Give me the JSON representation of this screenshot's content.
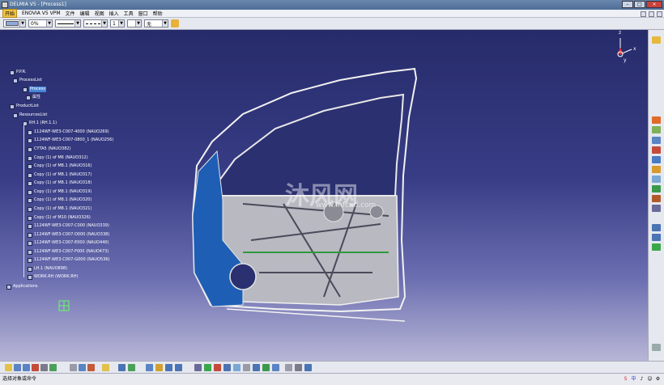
{
  "title": "DELMIA V5 - [Process1]",
  "window_buttons": [
    "–",
    "□",
    "×"
  ],
  "menu": [
    "开始",
    "ENOVIA V5 VPM",
    "文件",
    "编辑",
    "视图",
    "插入",
    "工具",
    "窗口",
    "帮助"
  ],
  "prop_toolbar": {
    "fill_value": "",
    "transparency_value": "0%",
    "linetype_value": "",
    "linestyle_value": "",
    "weight_value": "1",
    "layer_value": "无"
  },
  "tree": {
    "nodes": [
      {
        "label": "P.P.R.",
        "sel": false
      },
      {
        "label": "ProcessList",
        "sel": false
      },
      {
        "label": "Process",
        "sel": true
      },
      {
        "label": "属性",
        "sel": false
      },
      {
        "label": "ProductList",
        "sel": false
      },
      {
        "label": "ResourcesList",
        "sel": false
      },
      {
        "label": "RH.1 (RH.1.1)",
        "sel": false
      },
      {
        "label": "1124WF-WE3-C007-4000 (NAUO269)",
        "sel": false
      },
      {
        "label": "1124WF-WE3-C007-0800_1 (NAUO256)",
        "sel": false
      },
      {
        "label": "CYTA5 (NAUO382)",
        "sel": false
      },
      {
        "label": "Copy (1) of M6 (NAUO312)",
        "sel": false
      },
      {
        "label": "Copy (1) of M8.1 (NAUO316)",
        "sel": false
      },
      {
        "label": "Copy (1) of M8.1 (NAUO317)",
        "sel": false
      },
      {
        "label": "Copy (1) of M8.1 (NAUO318)",
        "sel": false
      },
      {
        "label": "Copy (1) of M8.1 (NAUO319)",
        "sel": false
      },
      {
        "label": "Copy (1) of M8.1 (NAUO320)",
        "sel": false
      },
      {
        "label": "Copy (1) of M8.1 (NAUO321)",
        "sel": false
      },
      {
        "label": "Copy (1) of M10 (NAUO326)",
        "sel": false
      },
      {
        "label": "1124WF-WE3-C007-C000 (NAUO339)",
        "sel": false
      },
      {
        "label": "1124WF-WE3-C007-D000 (NAUO338)",
        "sel": false
      },
      {
        "label": "1124WF-WE3-C007-E000 (NAUO440)",
        "sel": false
      },
      {
        "label": "1124WF-WE3-C007-F000 (NAUO473)",
        "sel": false
      },
      {
        "label": "1124WF-WE3-C007-G000 (NAUO536)",
        "sel": false
      },
      {
        "label": "LH.1 (NAUO898)",
        "sel": false
      },
      {
        "label": "WORK.RH (WORK.RH)",
        "sel": false
      },
      {
        "label": "Applications",
        "sel": false
      }
    ]
  },
  "watermark": {
    "main": "沐风网",
    "sub": "www.mfcad.com"
  },
  "compass_labels": {
    "x": "x",
    "y": "y",
    "z": "z"
  },
  "status_text": "选择对象或命令",
  "status_tray": [
    "S",
    "中",
    "♪",
    "☺",
    "⚙"
  ],
  "colors": {
    "titlebar": "#4e6d97",
    "viewport_top": "#262b6a",
    "viewport_bottom": "#b8b6d6",
    "selection": "#4a87d6",
    "menu_active": "#f4c544"
  }
}
